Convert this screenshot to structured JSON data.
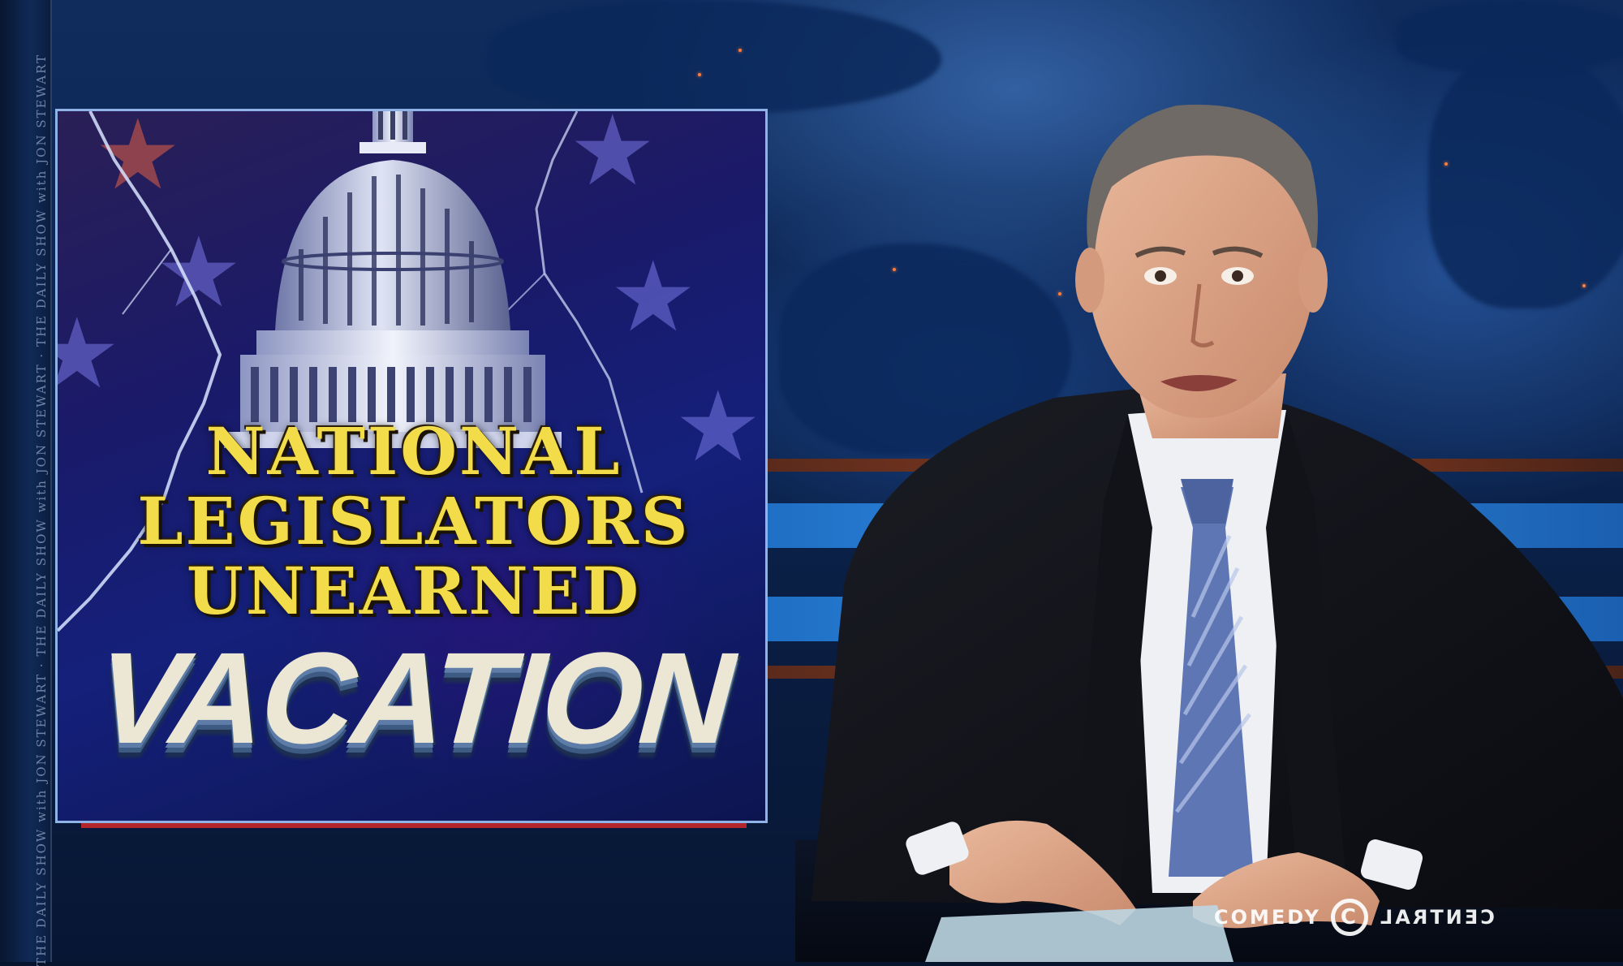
{
  "graphic": {
    "headline_lines": [
      "NATIONAL",
      "LEGISLATORS",
      "UNEARNED"
    ],
    "big_word": "VACATION"
  },
  "side_strip": {
    "text": "THE DAILY SHOW with JON STEWART · THE DAILY SHOW with JON STEWART · THE DAILY SHOW with JON STEWART"
  },
  "network_logo": {
    "left_text": "COMEDY",
    "mark": "C",
    "right_text": "CENTRAL"
  },
  "colors": {
    "headline_yellow": "#f3dc4a",
    "backdrop_blue": "#0b2450",
    "rule_red": "#b3262c"
  }
}
